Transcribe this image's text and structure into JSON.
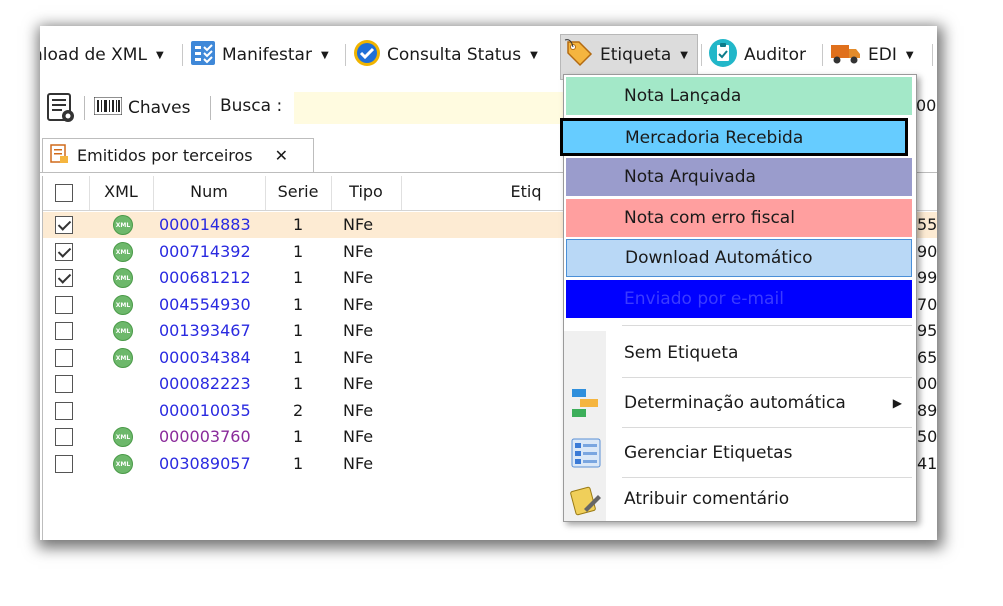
{
  "toolbar": {
    "download_xml": "nload de XML",
    "manifestar": "Manifestar",
    "consulta_status": "Consulta Status",
    "etiqueta": "Etiqueta",
    "auditor": "Auditor",
    "edi": "EDI"
  },
  "searchbar": {
    "chaves": "Chaves",
    "busca": "Busca :",
    "right_partial": "00"
  },
  "tab": {
    "label": "Emitidos por terceiros",
    "close": "✕"
  },
  "grid": {
    "headers": {
      "xml": "XML",
      "num": "Num",
      "serie": "Serie",
      "tipo": "Tipo",
      "etiq": "Etiq"
    },
    "rows": [
      {
        "checked": true,
        "xml": "XML",
        "num": "000014883",
        "serie": "1",
        "tipo": "NFe",
        "tail": "55"
      },
      {
        "checked": true,
        "xml": "XML",
        "num": "000714392",
        "serie": "1",
        "tipo": "NFe",
        "tail": "90"
      },
      {
        "checked": true,
        "xml": "XML",
        "num": "000681212",
        "serie": "1",
        "tipo": "NFe",
        "tail": "99"
      },
      {
        "checked": false,
        "xml": "XML",
        "num": "004554930",
        "serie": "1",
        "tipo": "NFe",
        "tail": "70"
      },
      {
        "checked": false,
        "xml": "XML",
        "num": "001393467",
        "serie": "1",
        "tipo": "NFe",
        "tail": "95"
      },
      {
        "checked": false,
        "xml": "XML",
        "num": "000034384",
        "serie": "1",
        "tipo": "NFe",
        "tail": "65"
      },
      {
        "checked": false,
        "xml": "",
        "num": "000082223",
        "serie": "1",
        "tipo": "NFe",
        "tail": "00"
      },
      {
        "checked": false,
        "xml": "",
        "num": "000010035",
        "serie": "2",
        "tipo": "NFe",
        "tail": "89"
      },
      {
        "checked": false,
        "xml": "XML",
        "num": "000003760",
        "serie": "1",
        "tipo": "NFe",
        "tail": "50"
      },
      {
        "checked": false,
        "xml": "XML",
        "num": "003089057",
        "serie": "1",
        "tipo": "NFe",
        "tail": "41"
      }
    ]
  },
  "menu": {
    "labels": [
      {
        "text": "Nota Lançada",
        "bg": "#a3e8c8",
        "color": "#1a1a1a"
      },
      {
        "text": "Mercadoria Recebida",
        "bg": "#66ccff",
        "color": "#1a1a1a"
      },
      {
        "text": "Nota Arquivada",
        "bg": "#9a9ccc",
        "color": "#1a1a1a"
      },
      {
        "text": "Nota com erro fiscal",
        "bg": "#ff9f9f",
        "color": "#1a1a1a"
      },
      {
        "text": "Download Automático",
        "bg": "#b9d8f6",
        "color": "#1a1a1a"
      },
      {
        "text": "Enviado por e-mail",
        "bg": "#0000ff",
        "color": "#3b3bff"
      }
    ],
    "sem_etiqueta": "Sem Etiqueta",
    "determinacao": "Determinação automática",
    "gerenciar": "Gerenciar Etiquetas",
    "atribuir": "Atribuir comentário"
  },
  "colors": {
    "link_blue": "#2a2ae0",
    "link_purple": "#8a2a9a",
    "selected_row": "#fdebd3"
  }
}
